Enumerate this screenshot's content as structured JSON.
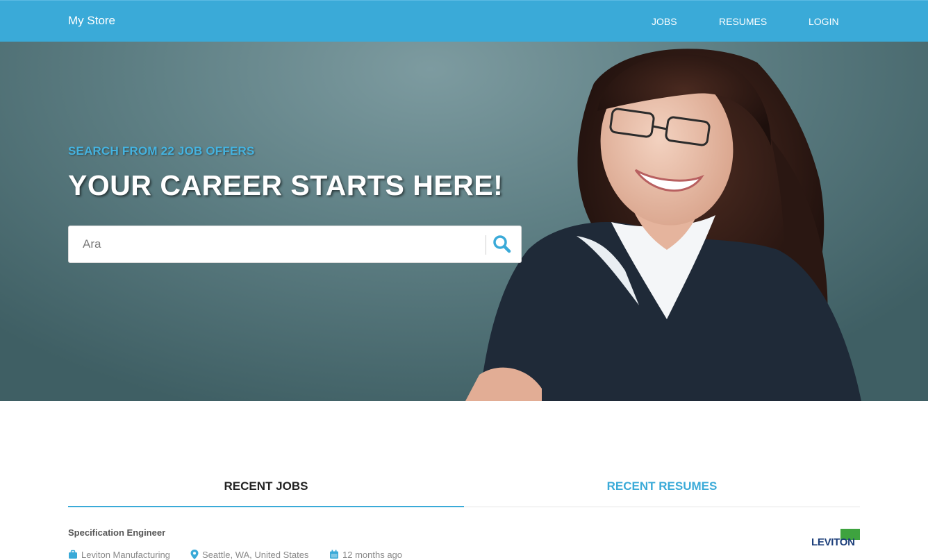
{
  "nav": {
    "brand": "My Store",
    "links": [
      "JOBS",
      "RESUMES",
      "LOGIN"
    ]
  },
  "hero": {
    "subtitle": "SEARCH FROM 22 JOB OFFERS",
    "title": "YOUR CAREER STARTS HERE!",
    "search_placeholder": "Ara",
    "search_value": ""
  },
  "tabs": [
    "RECENT JOBS",
    "RECENT RESUMES"
  ],
  "active_tab": "RECENT JOBS",
  "jobs": [
    {
      "title": "Specification Engineer",
      "company": "Leviton Manufacturing",
      "location": "Seattle, WA, United States",
      "posted": "12 months ago",
      "logo_text": "LEVITON"
    }
  ],
  "colors": {
    "accent": "#3aaad8",
    "logo_green": "#3ea33f"
  },
  "icons": [
    "search-icon",
    "briefcase-icon",
    "map-marker-icon",
    "calendar-icon"
  ]
}
